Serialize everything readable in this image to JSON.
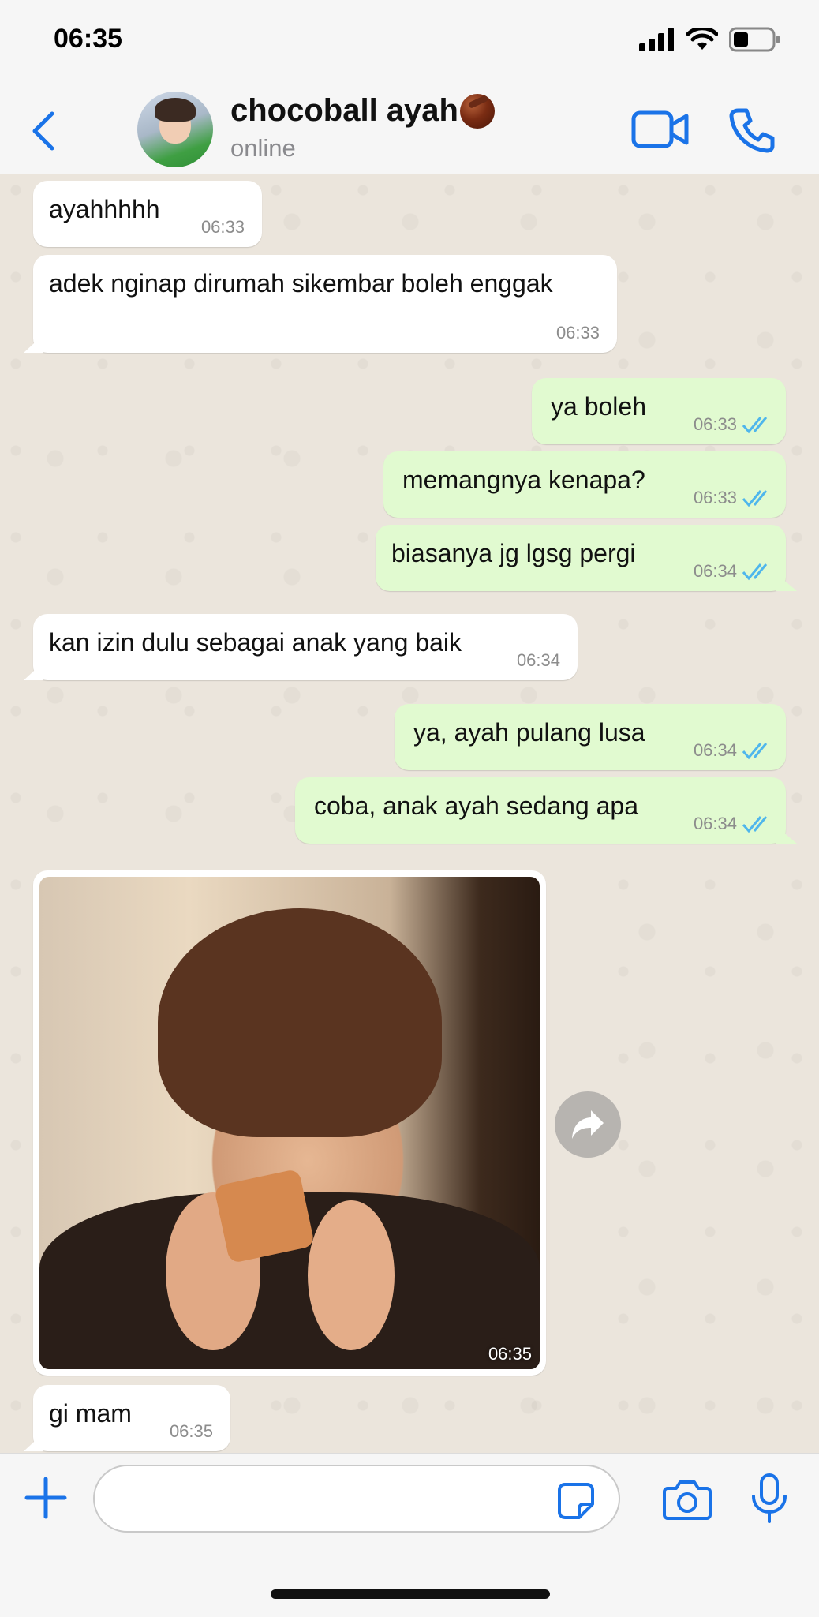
{
  "status_bar": {
    "time": "06:35"
  },
  "header": {
    "contact_name": "chocoball ayah",
    "contact_status": "online"
  },
  "messages": [
    {
      "text": "ayahhhhh",
      "time": "06:33",
      "dir": "in"
    },
    {
      "text": "adek nginap dirumah sikembar boleh enggak",
      "time": "06:33",
      "dir": "in"
    },
    {
      "text": "ya boleh",
      "time": "06:33",
      "dir": "out"
    },
    {
      "text": "memangnya kenapa?",
      "time": "06:33",
      "dir": "out"
    },
    {
      "text": "biasanya jg lgsg pergi",
      "time": "06:34",
      "dir": "out"
    },
    {
      "text": "kan izin dulu sebagai anak yang baik",
      "time": "06:34",
      "dir": "in"
    },
    {
      "text": "ya, ayah pulang lusa",
      "time": "06:34",
      "dir": "out"
    },
    {
      "text": "coba, anak ayah sedang apa",
      "time": "06:34",
      "dir": "out"
    },
    {
      "text": "gi mam",
      "time": "06:35",
      "dir": "in"
    }
  ],
  "photo_message": {
    "time": "06:35"
  },
  "input": {
    "placeholder": ""
  },
  "colors": {
    "accent": "#1a73e8",
    "outgoing_bubble": "#e1fad0",
    "incoming_bubble": "#ffffff",
    "read_ticks": "#4fb6ec"
  },
  "icons": [
    "back-icon",
    "video-call-icon",
    "phone-icon",
    "forward-icon",
    "plus-icon",
    "sticker-icon",
    "camera-icon",
    "microphone-icon",
    "double-check-icon"
  ]
}
